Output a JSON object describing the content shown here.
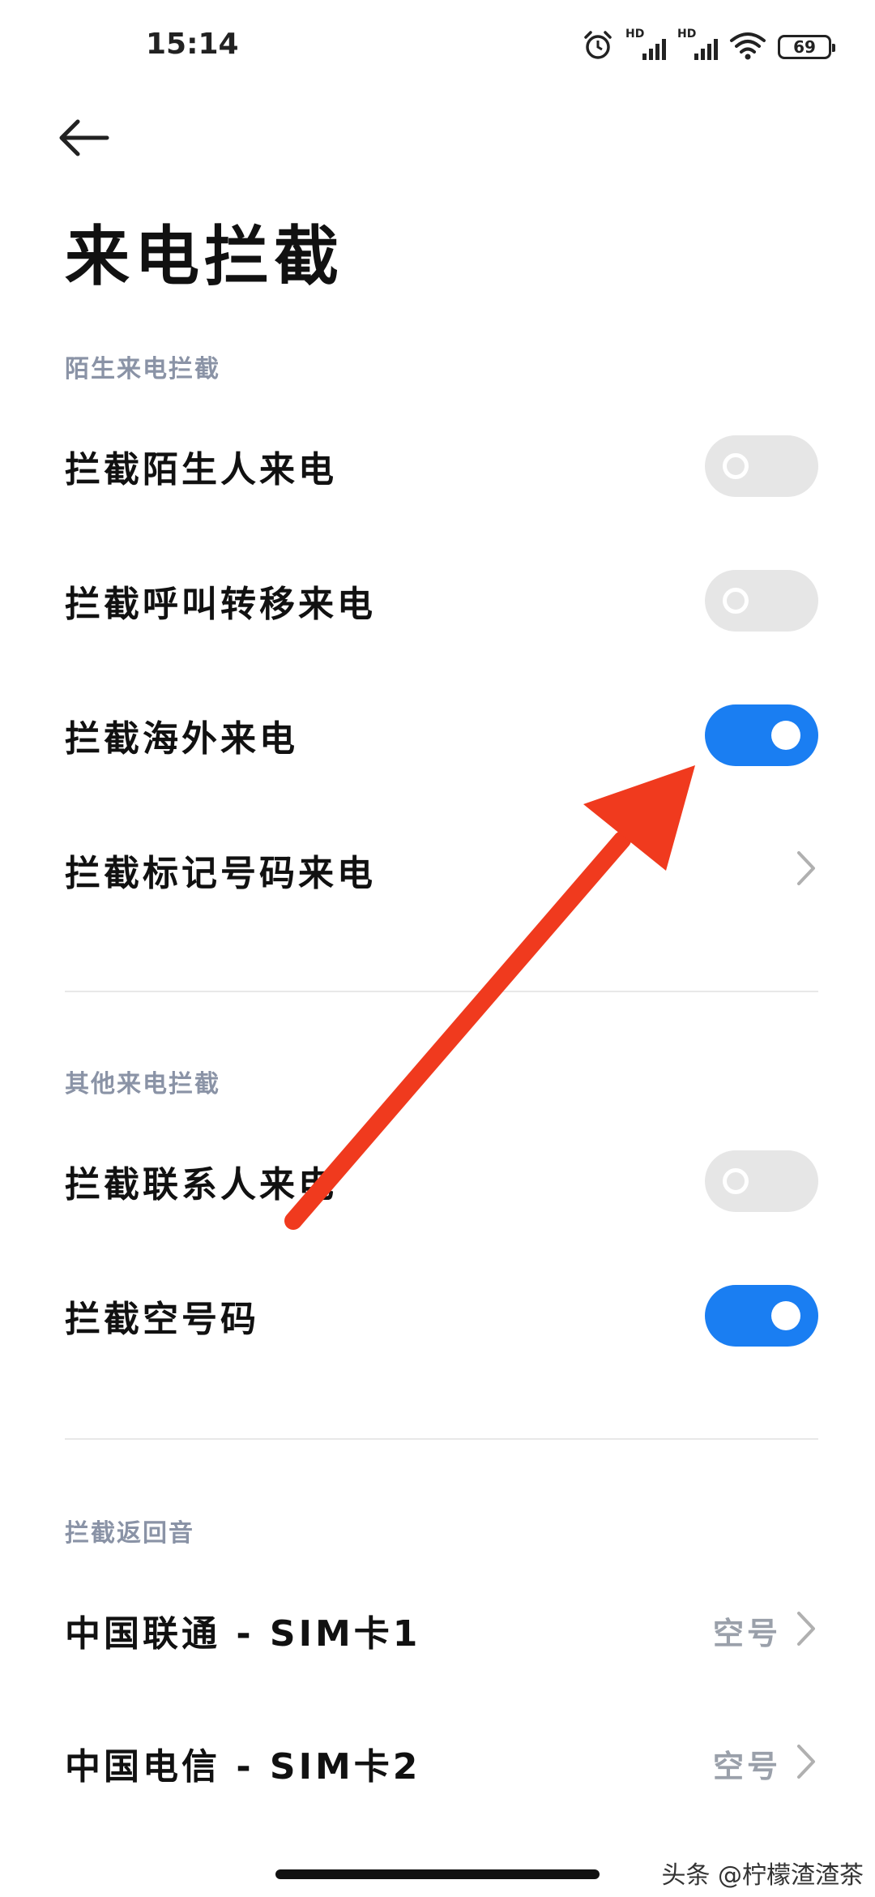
{
  "status_bar": {
    "time": "15:14",
    "hd_label": "HD",
    "battery": "69",
    "icons": [
      "alarm-icon",
      "signal-hd-icon",
      "signal-hd-icon",
      "wifi-icon",
      "battery-icon"
    ]
  },
  "header": {
    "back_icon": "arrow-left-icon",
    "title": "来电拦截"
  },
  "sections": [
    {
      "title": "陌生来电拦截",
      "items": [
        {
          "label": "拦截陌生人来电",
          "control": "toggle",
          "on": false
        },
        {
          "label": "拦截呼叫转移来电",
          "control": "toggle",
          "on": false
        },
        {
          "label": "拦截海外来电",
          "control": "toggle",
          "on": true
        },
        {
          "label": "拦截标记号码来电",
          "control": "chevron"
        }
      ]
    },
    {
      "title": "其他来电拦截",
      "items": [
        {
          "label": "拦截联系人来电",
          "control": "toggle",
          "on": false
        },
        {
          "label": "拦截空号码",
          "control": "toggle",
          "on": true
        }
      ]
    },
    {
      "title": "拦截返回音",
      "items": [
        {
          "label": "中国联通 - SIM卡1",
          "value": "空号",
          "control": "chevron"
        },
        {
          "label": "中国电信 - SIM卡2",
          "value": "空号",
          "control": "chevron"
        }
      ]
    }
  ],
  "colors": {
    "toggle_on": "#1a7ef2",
    "toggle_off": "#e6e6e6",
    "section_header": "#8a93a6",
    "annotation_arrow": "#f03a1e"
  },
  "watermark": "头条 @柠檬渣渣茶"
}
